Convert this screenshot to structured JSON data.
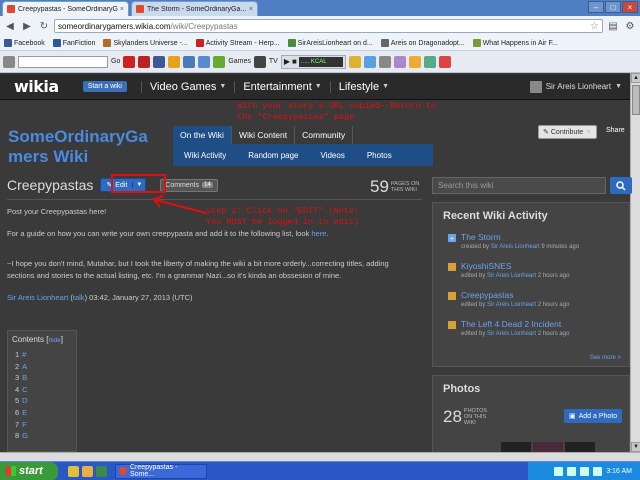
{
  "browser": {
    "tabs": [
      {
        "label": "Creepypastas - SomeOrdinaryG...",
        "active": true
      },
      {
        "label": "The Storm - SomeOrdinaryGa...",
        "active": false
      }
    ],
    "url_host": "someordinarygamers.wikia.com",
    "url_path": "/wiki/Creepypastas",
    "bookmarks": [
      {
        "label": "Facebook",
        "color": "#3b5998"
      },
      {
        "label": "FanFiction",
        "color": "#2a5a9a"
      },
      {
        "label": "Skylanders Universe -...",
        "color": "#b06a2a"
      },
      {
        "label": "Activity Stream - Herp...",
        "color": "#c22"
      },
      {
        "label": "SirAreisLionheart on d...",
        "color": "#4a8a3a"
      },
      {
        "label": "Areis on Dragonadopt...",
        "color": "#666"
      },
      {
        "label": "What Happens in Air F...",
        "color": "#7a9a3a"
      }
    ],
    "toolbar": {
      "go_label": "Go",
      "games_label": "Games",
      "tv_label": "TV",
      "station": "..... KCAL"
    }
  },
  "wikia": {
    "logo": "wikia",
    "start_wiki": "Start a wiki",
    "global_nav": [
      "Video Games",
      "Entertainment",
      "Lifestyle"
    ],
    "user": "Sir Areis Lionheart"
  },
  "wiki": {
    "name": "SomeOrdinaryGamers Wiki",
    "name_line1": "SomeOrdinaryGa",
    "name_line2": "mers Wiki",
    "tabs": [
      "On the Wiki",
      "Wiki Content",
      "Community"
    ],
    "subnav": [
      "Wiki Activity",
      "Random page",
      "Videos",
      "Photos"
    ],
    "contribute": "Contribute",
    "share": "Share"
  },
  "article": {
    "title": "Creepypastas",
    "edit_label": "Edit",
    "comments_label": "Comments",
    "comments_count": "14",
    "pages_count": "59",
    "pages_label": "PAGES ON THIS WIKI",
    "intro": "Post your Creepypastas here!",
    "guide_text": "For a guide on how you can write your own creepypasta and add it to the following list, look",
    "guide_link": "here",
    "note": "~I hope you don't mind, Mutahar, but I took the liberty of making the wiki a bit more orderly...correcting titles, adding sections and stories to the actual listing, etc. I'm a grammar Nazi...so it's kinda an obssesion of mine.",
    "sig_user": "Sir Areis Lionheart",
    "sig_talk": "talk",
    "sig_time": "03:42, January 27, 2013 (UTC)",
    "toc_title": "Contents",
    "toc_hide": "hide",
    "toc_items": [
      {
        "n": "1",
        "label": "#"
      },
      {
        "n": "2",
        "label": "A"
      },
      {
        "n": "3",
        "label": "B"
      },
      {
        "n": "4",
        "label": "C"
      },
      {
        "n": "5",
        "label": "D"
      },
      {
        "n": "6",
        "label": "E"
      },
      {
        "n": "7",
        "label": "F"
      },
      {
        "n": "8",
        "label": "G"
      }
    ]
  },
  "annotations": {
    "a1_line1": "With your story's URL copied--Return to",
    "a1_line2": "the \"Creepypastas\" page",
    "a2_line1": "Step 2: Click on \"EDIT\" (Note:",
    "a2_line2": "You MUST be logged in to edit)",
    "color": "#e01010"
  },
  "rail": {
    "search_placeholder": "Search this wiki",
    "activity_title": "Recent Wiki Activity",
    "activity": [
      {
        "title": "The Storm",
        "verb": "created by",
        "user": "Sir Areis Lionheart",
        "time": "9 minutes ago"
      },
      {
        "title": "KiyoshiSNES",
        "verb": "edited by",
        "user": "Sir Areis Lionheart",
        "time": "2 hours ago"
      },
      {
        "title": "Creepypastas",
        "verb": "edited by",
        "user": "Sir Areis Lionheart",
        "time": "2 hours ago"
      },
      {
        "title": "The Left 4 Dead 2 Incident",
        "verb": "edited by",
        "user": "Sir Areis Lionheart",
        "time": "2 hours ago"
      }
    ],
    "see_more": "See more >",
    "photos_title": "Photos",
    "photos_count": "28",
    "photos_label": "PHOTOS ON THIS WIKI",
    "add_photo": "Add a Photo"
  },
  "taskbar": {
    "start": "start",
    "task": "Creepypastas - Some...",
    "clock": "3:16 AM"
  }
}
